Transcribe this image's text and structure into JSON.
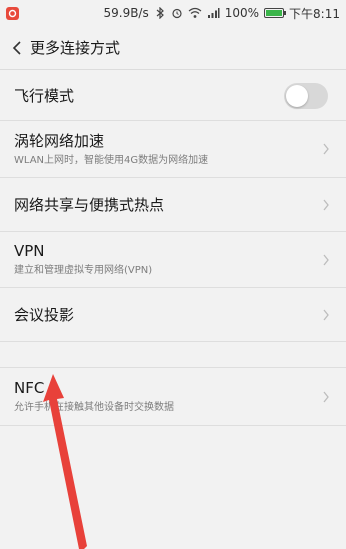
{
  "status_bar": {
    "speed": "59.9B/s",
    "battery_percent": "100%",
    "time": "下午8:11",
    "battery_level": 1.0
  },
  "header": {
    "title": "更多连接方式"
  },
  "settings": [
    {
      "title": "飞行模式",
      "subtitle": "",
      "control": "toggle",
      "enabled": false
    },
    {
      "title": "涡轮网络加速",
      "subtitle": "WLAN上网时，智能使用4G数据为网络加速",
      "control": "chevron"
    },
    {
      "title": "网络共享与便携式热点",
      "subtitle": "",
      "control": "chevron"
    },
    {
      "title": "VPN",
      "subtitle": "建立和管理虚拟专用网络(VPN)",
      "control": "chevron"
    },
    {
      "title": "会议投影",
      "subtitle": "",
      "control": "chevron"
    },
    {
      "title": "NFC",
      "subtitle": "允许手机在接触其他设备时交换数据",
      "control": "chevron"
    }
  ],
  "colors": {
    "arrow": "#e8413a",
    "battery_fill": "#3bb54a"
  }
}
